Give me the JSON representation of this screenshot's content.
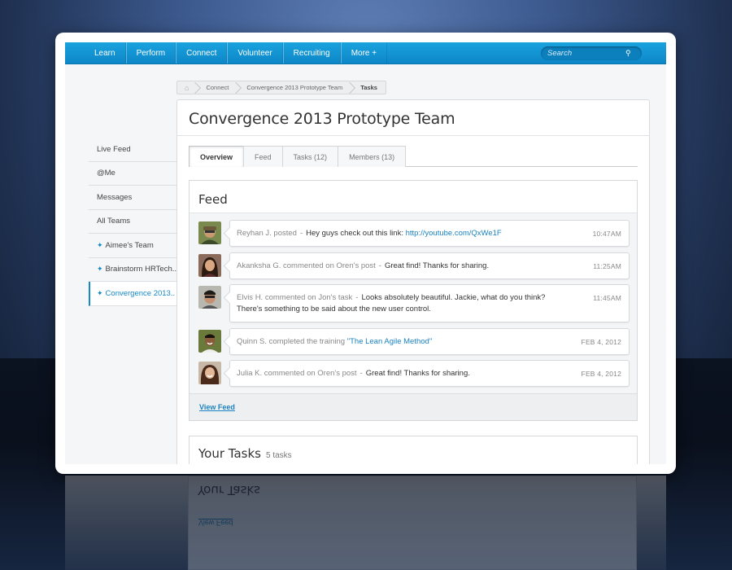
{
  "nav": {
    "items": [
      {
        "label": "Learn"
      },
      {
        "label": "Perform"
      },
      {
        "label": "Connect"
      },
      {
        "label": "Volunteer"
      },
      {
        "label": "Recruiting"
      },
      {
        "label": "More +"
      }
    ],
    "search_placeholder": "Search"
  },
  "breadcrumb": {
    "items": [
      "Connect",
      "Convergence 2013 Prototype Team",
      "Tasks"
    ]
  },
  "sidebar": {
    "items": [
      {
        "label": "Live Feed",
        "pinned": false
      },
      {
        "label": "@Me",
        "pinned": false
      },
      {
        "label": "Messages",
        "pinned": false
      },
      {
        "label": "All Teams",
        "pinned": false
      },
      {
        "label": "Aimee's Team",
        "pinned": true
      },
      {
        "label": "Brainstorm HRTech..",
        "pinned": true
      },
      {
        "label": "Convergence 2013..",
        "pinned": true,
        "active": true
      }
    ]
  },
  "page": {
    "title": "Convergence 2013 Prototype Team",
    "tabs": [
      {
        "label": "Overview",
        "active": true
      },
      {
        "label": "Feed"
      },
      {
        "label": "Tasks (12)"
      },
      {
        "label": "Members (13)"
      }
    ]
  },
  "feed": {
    "title": "Feed",
    "items": [
      {
        "actor": "Reyhan J.  posted",
        "sep": "-",
        "message": "Hey guys check out this link:",
        "link": "http://youtube.com/QxWe1F",
        "time": "10:47AM"
      },
      {
        "actor": "Akanksha G. commented on Oren's post",
        "sep": "-",
        "message": "Great find! Thanks for sharing.",
        "time": "11:25AM"
      },
      {
        "actor": "Elvis H. commented on Jon's task",
        "sep": "-",
        "message": "Looks absolutely beautiful. Jackie, what do you think? There's something to be said about the new user control.",
        "time": "11:45AM"
      },
      {
        "actor": "Quinn S. completed the training",
        "link": "\"The Lean Agile Method\"",
        "time": "FEB 4, 2012"
      },
      {
        "actor": "Julia K. commented on Oren's post",
        "sep": "-",
        "message": "Great find! Thanks for sharing.",
        "time": "FEB 4, 2012"
      }
    ],
    "view_feed_label": "View Feed"
  },
  "tasks": {
    "title": "Your Tasks",
    "count": "5 tasks"
  },
  "colors": {
    "accent": "#1588c6",
    "nav_blue": "#1aa3de"
  }
}
